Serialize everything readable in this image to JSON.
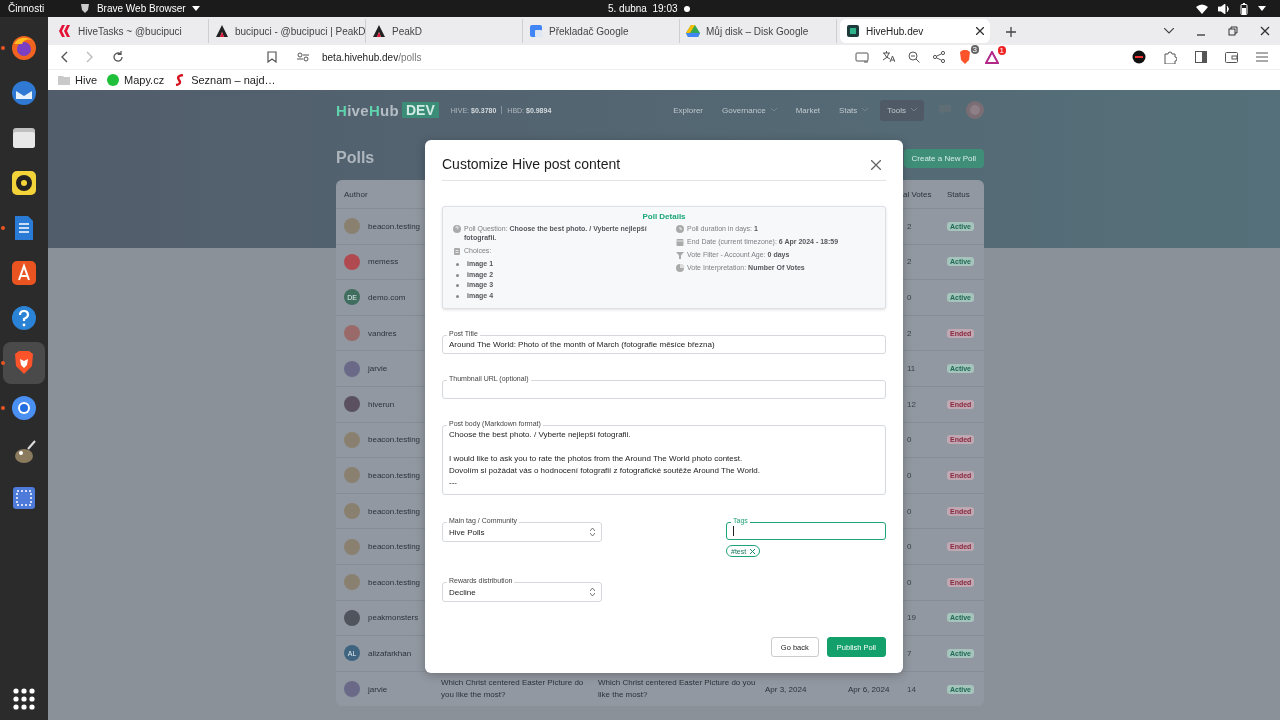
{
  "system_bar": {
    "activities": "Činnosti",
    "app": "Brave Web Browser",
    "date": "5. dubna",
    "time": "19:03"
  },
  "dock": [
    {
      "kind": "firefox",
      "running": true,
      "selected": false
    },
    {
      "kind": "mail",
      "running": false,
      "selected": false
    },
    {
      "kind": "files",
      "running": false,
      "selected": false
    },
    {
      "kind": "music",
      "running": false,
      "selected": false
    },
    {
      "kind": "writer",
      "running": true,
      "selected": false
    },
    {
      "kind": "store",
      "running": false,
      "selected": false
    },
    {
      "kind": "help",
      "running": false,
      "selected": false
    },
    {
      "kind": "brave",
      "running": true,
      "selected": true
    },
    {
      "kind": "chromium",
      "running": true,
      "selected": false
    },
    {
      "kind": "gimp",
      "running": false,
      "selected": false
    },
    {
      "kind": "screenshot",
      "running": false,
      "selected": false
    }
  ],
  "browser": {
    "tabs": [
      {
        "title": "HiveTasks ~ @bucipuci",
        "kind": "hive",
        "selected": false
      },
      {
        "title": "bucipuci - @bucipuci | PeakD",
        "kind": "peakd",
        "selected": false
      },
      {
        "title": "PeakD",
        "kind": "peakd",
        "selected": false
      },
      {
        "title": "Překladač Google",
        "kind": "translate",
        "selected": false
      },
      {
        "title": "Můj disk – Disk Google",
        "kind": "drive",
        "selected": false
      },
      {
        "title": "HiveHub.dev",
        "kind": "hivehub",
        "selected": true
      }
    ],
    "url_host": "beta.hivehub.dev",
    "url_path": "/polls",
    "shields_badge": "3",
    "rewards_badge": "1",
    "bookmarks": [
      {
        "label": "Hive",
        "kind": "folder"
      },
      {
        "label": "Mapy.cz",
        "kind": "mapy"
      },
      {
        "label": "Seznam – najd…",
        "kind": "seznam"
      }
    ]
  },
  "site": {
    "logo": [
      {
        "text": "H",
        "accent": true
      },
      {
        "text": "ive",
        "accent": false
      },
      {
        "text": "H",
        "accent": true
      },
      {
        "text": "ub",
        "accent": false
      }
    ],
    "logo_badge": "DEV",
    "prices": [
      {
        "label": "HIVE:",
        "value": "$0.3780"
      },
      {
        "label": "HBD:",
        "value": "$0.9894"
      }
    ],
    "nav": [
      {
        "label": "Explorer",
        "dropdown": false,
        "selected": false
      },
      {
        "label": "Governance",
        "dropdown": true,
        "selected": false
      },
      {
        "label": "Market",
        "dropdown": false,
        "selected": false
      },
      {
        "label": "Stats",
        "dropdown": true,
        "selected": false
      },
      {
        "label": "Tools",
        "dropdown": true,
        "selected": true
      }
    ],
    "page_title": "Polls",
    "create_button": "Create a New Poll"
  },
  "table": {
    "columns": [
      "Author",
      "al Votes",
      "Status"
    ],
    "rows": [
      {
        "author": "beacon.testing",
        "color": "#8a8070",
        "votes": "2",
        "status": "Active",
        "kind": "active"
      },
      {
        "author": "memess",
        "color": "#b04a50",
        "votes": "2",
        "status": "Active",
        "kind": "active"
      },
      {
        "author": "demo.com",
        "color": "#3f6e5e",
        "initials": "DE",
        "votes": "0",
        "status": "Active",
        "kind": "active"
      },
      {
        "author": "vandres",
        "color": "#9a6a6a",
        "votes": "2",
        "status": "Ended",
        "kind": "ended"
      },
      {
        "author": "jarvie",
        "color": "#6a6a88",
        "votes": "11",
        "status": "Active",
        "kind": "active"
      },
      {
        "author": "hiverun",
        "color": "#5a5060",
        "votes": "12",
        "status": "Ended",
        "kind": "ended"
      },
      {
        "author": "beacon.testing",
        "color": "#8a8070",
        "votes": "0",
        "status": "Ended",
        "kind": "ended"
      },
      {
        "author": "beacon.testing",
        "color": "#8a8070",
        "votes": "0",
        "status": "Ended",
        "kind": "ended"
      },
      {
        "author": "beacon.testing",
        "color": "#8a8070",
        "votes": "0",
        "status": "Ended",
        "kind": "ended"
      },
      {
        "author": "beacon.testing",
        "color": "#8a8070",
        "votes": "0",
        "status": "Ended",
        "kind": "ended"
      },
      {
        "author": "beacon.testing",
        "color": "#8a8070",
        "votes": "0",
        "status": "Ended",
        "kind": "ended"
      },
      {
        "author": "peakmonsters",
        "color": "#50545c",
        "votes": "19",
        "status": "Active",
        "kind": "active"
      },
      {
        "author": "alizafarkhan",
        "color": "#3e6480",
        "initials": "AL",
        "votes": "7",
        "status": "Active",
        "kind": "active"
      },
      {
        "author": "jarvie",
        "color": "#6a6a88",
        "question": "Which Christ centered Easter Picture do you like the most?",
        "title": "Which Christ centered Easter Picture do you like the most?",
        "start": "Apr 3, 2024",
        "end": "Apr 6, 2024",
        "votes": "14",
        "status": "Active",
        "kind": "active"
      }
    ]
  },
  "modal": {
    "title": "Customize Hive post content",
    "details": {
      "title": "Poll Details",
      "left": [
        {
          "kind": "question",
          "text": "Poll Question: **Choose the best photo. / Vyberte nejlepší fotografii.**"
        },
        {
          "kind": "choices",
          "text": "Choices:"
        }
      ],
      "choices": [
        "image 1",
        "image 2",
        "image 3",
        "image 4"
      ],
      "right": [
        {
          "kind": "clock",
          "text": "Poll duration in days: **1**"
        },
        {
          "kind": "calendar",
          "text": "End Date (current timezone): **6 Apr 2024 - 18:59**"
        },
        {
          "kind": "filter",
          "text": "Vote Filter - Account Age: **0 days**"
        },
        {
          "kind": "chart",
          "text": "Vote Interpretation: **Number Of Votes**"
        }
      ]
    },
    "post_title": {
      "label": "Post Title",
      "value": "Around The World: Photo of the month of March (fotografie měsíce března)"
    },
    "thumbnail": {
      "label": "Thumbnail URL",
      "hint": "(optional)"
    },
    "body": {
      "label": "Post body",
      "hint": "(Markdown format)",
      "value": "Choose the best photo. / Vyberte nejlepší fotografii.\n\nI would like to ask you to rate the photos from the Around The World photo contest.\nDovolím si požádat vás o hodnocení fotografií z fotografické soutěže Around The World.\n---"
    },
    "main_tag": {
      "label": "Main tag / Community",
      "value": "Hive Polls"
    },
    "tags": {
      "label": "Tags",
      "focused": true,
      "chips": [
        "#test"
      ]
    },
    "rewards": {
      "label": "Rewards distribution",
      "value": "Decline"
    },
    "buttons": [
      {
        "label": "Go back",
        "kind": "secondary"
      },
      {
        "label": "Publish Poll",
        "kind": "primary"
      }
    ]
  }
}
